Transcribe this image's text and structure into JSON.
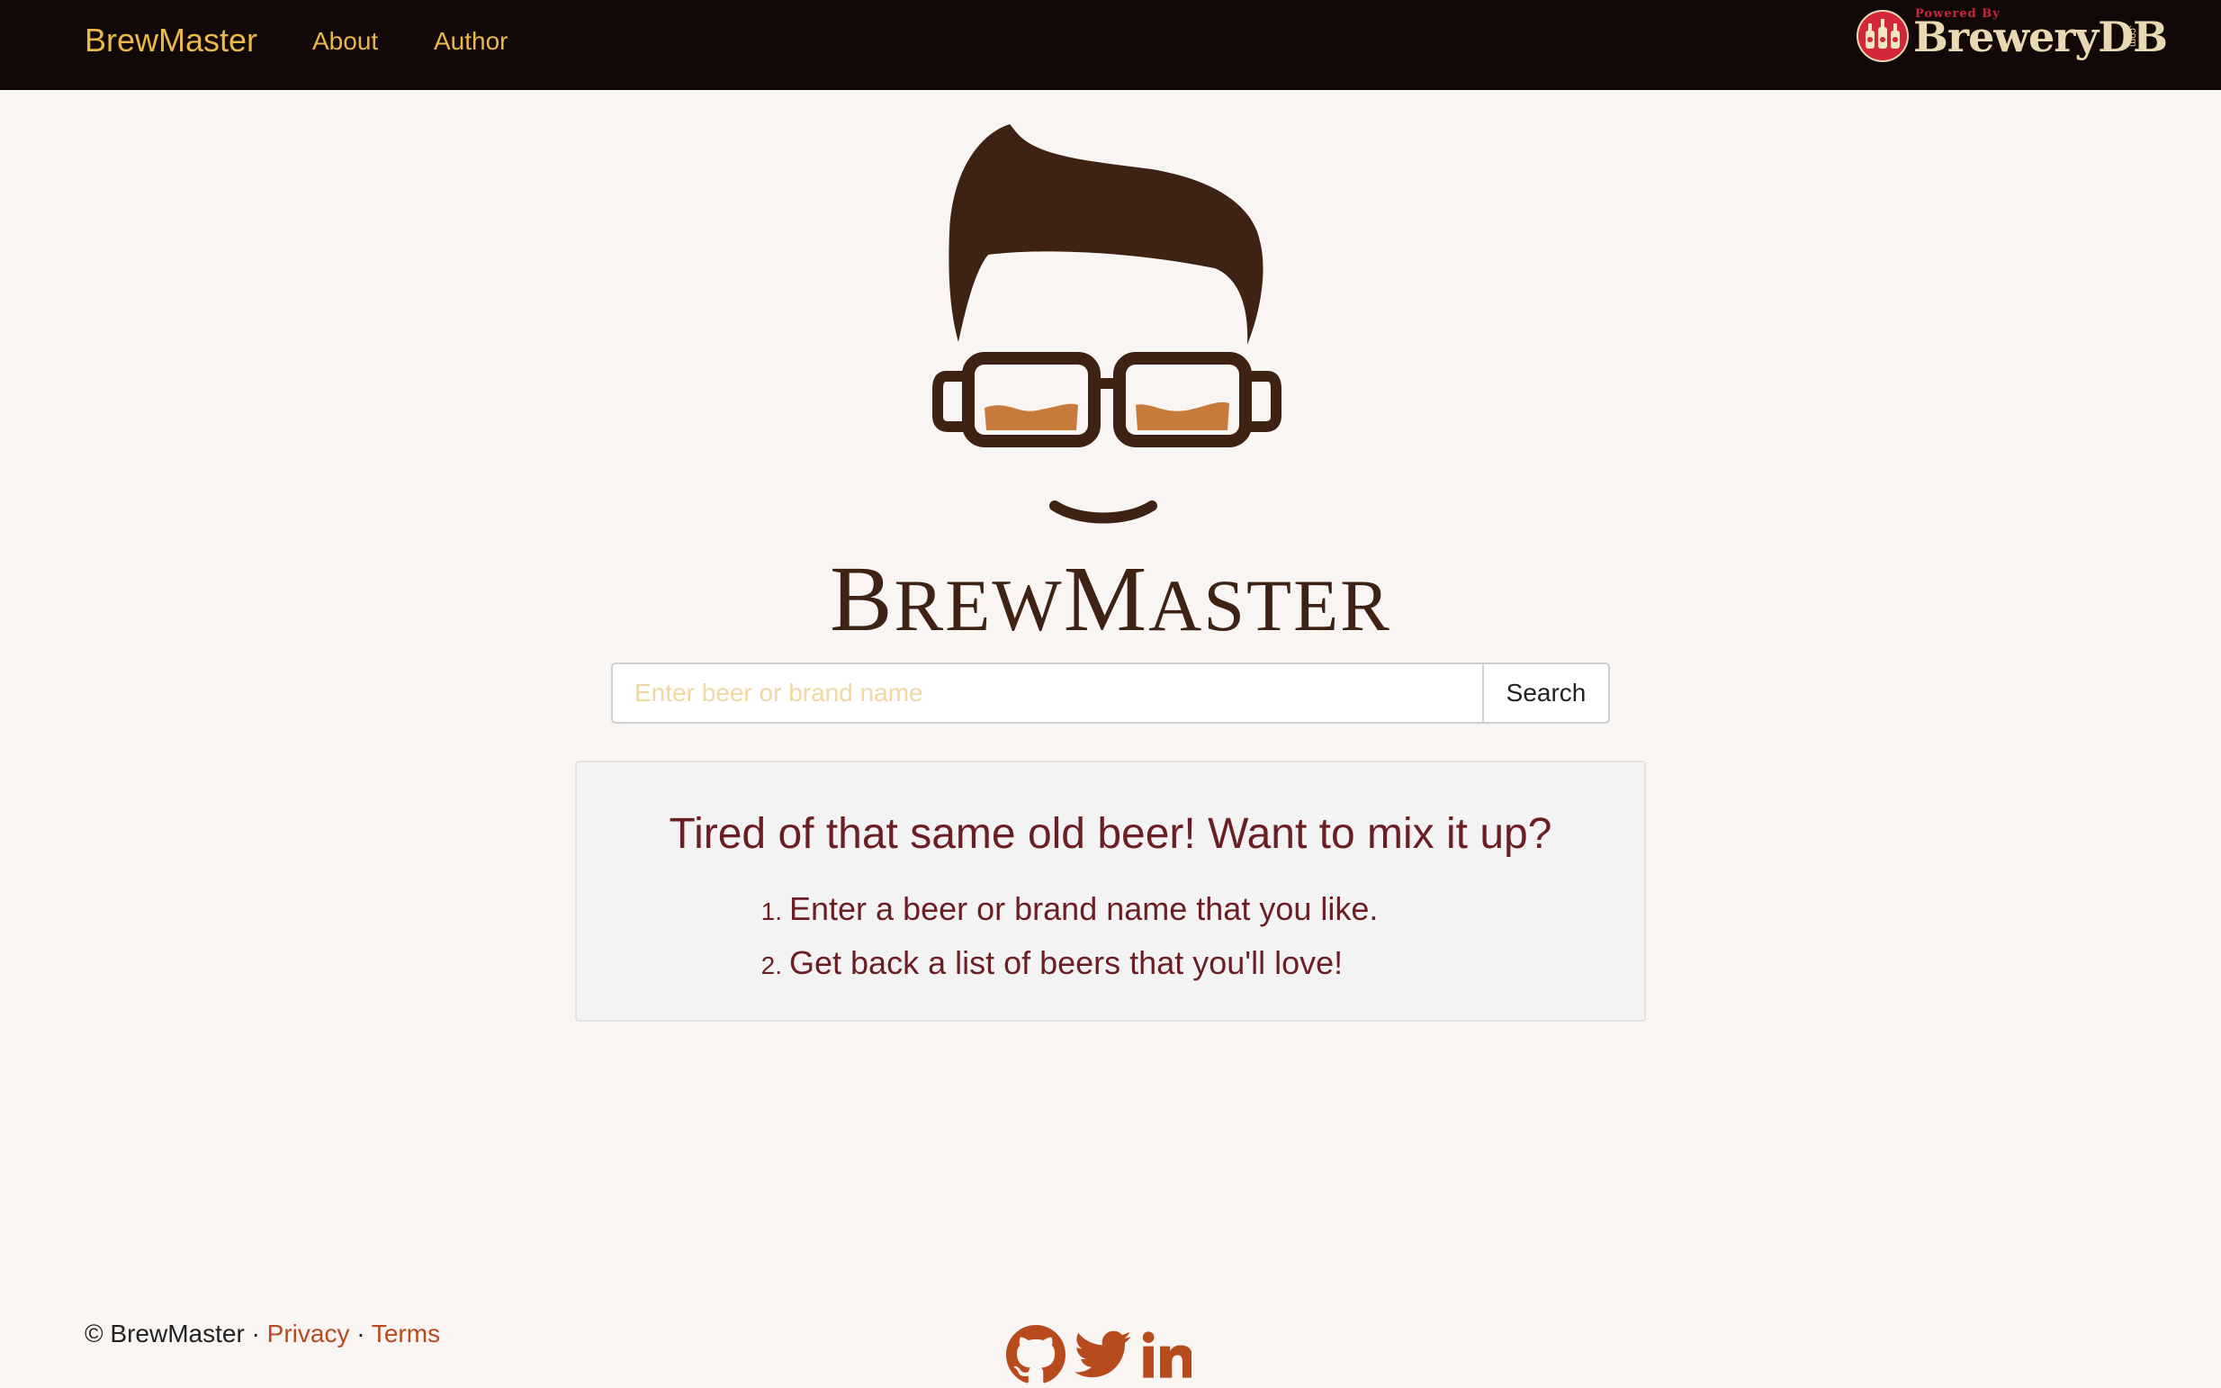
{
  "nav": {
    "brand": "BrewMaster",
    "links": [
      "About",
      "Author"
    ],
    "powered_by": {
      "label": "Powered By",
      "name": "BreweryDB",
      "suffix": ".com",
      "icon": "brewerydb-bottles-badge"
    }
  },
  "logo": {
    "icon": "hipster-face-beer-glasses-logo",
    "wordmark_first": "B",
    "wordmark_rest1": "REW",
    "wordmark_mid": "M",
    "wordmark_rest2": "ASTER"
  },
  "search": {
    "placeholder": "Enter beer or brand name",
    "value": "",
    "button": "Search"
  },
  "intro": {
    "title": "Tired of that same old beer! Want to mix it up?",
    "steps": [
      {
        "num": "1.",
        "text": "Enter a beer or brand name that you like."
      },
      {
        "num": "2.",
        "text": "Get back a list of beers that you'll love!"
      }
    ]
  },
  "footer": {
    "copyright": "© BrewMaster",
    "separator": "·",
    "privacy": "Privacy",
    "terms": "Terms",
    "social_icons": [
      "github-icon",
      "twitter-icon",
      "linkedin-icon"
    ]
  },
  "colors": {
    "navbar_bg": "#120808",
    "nav_text": "#e8b84a",
    "accent": "#b84b1d",
    "heading": "#6b1f24",
    "logo_brown": "#3e2214",
    "beer_amber": "#c77b3a"
  }
}
